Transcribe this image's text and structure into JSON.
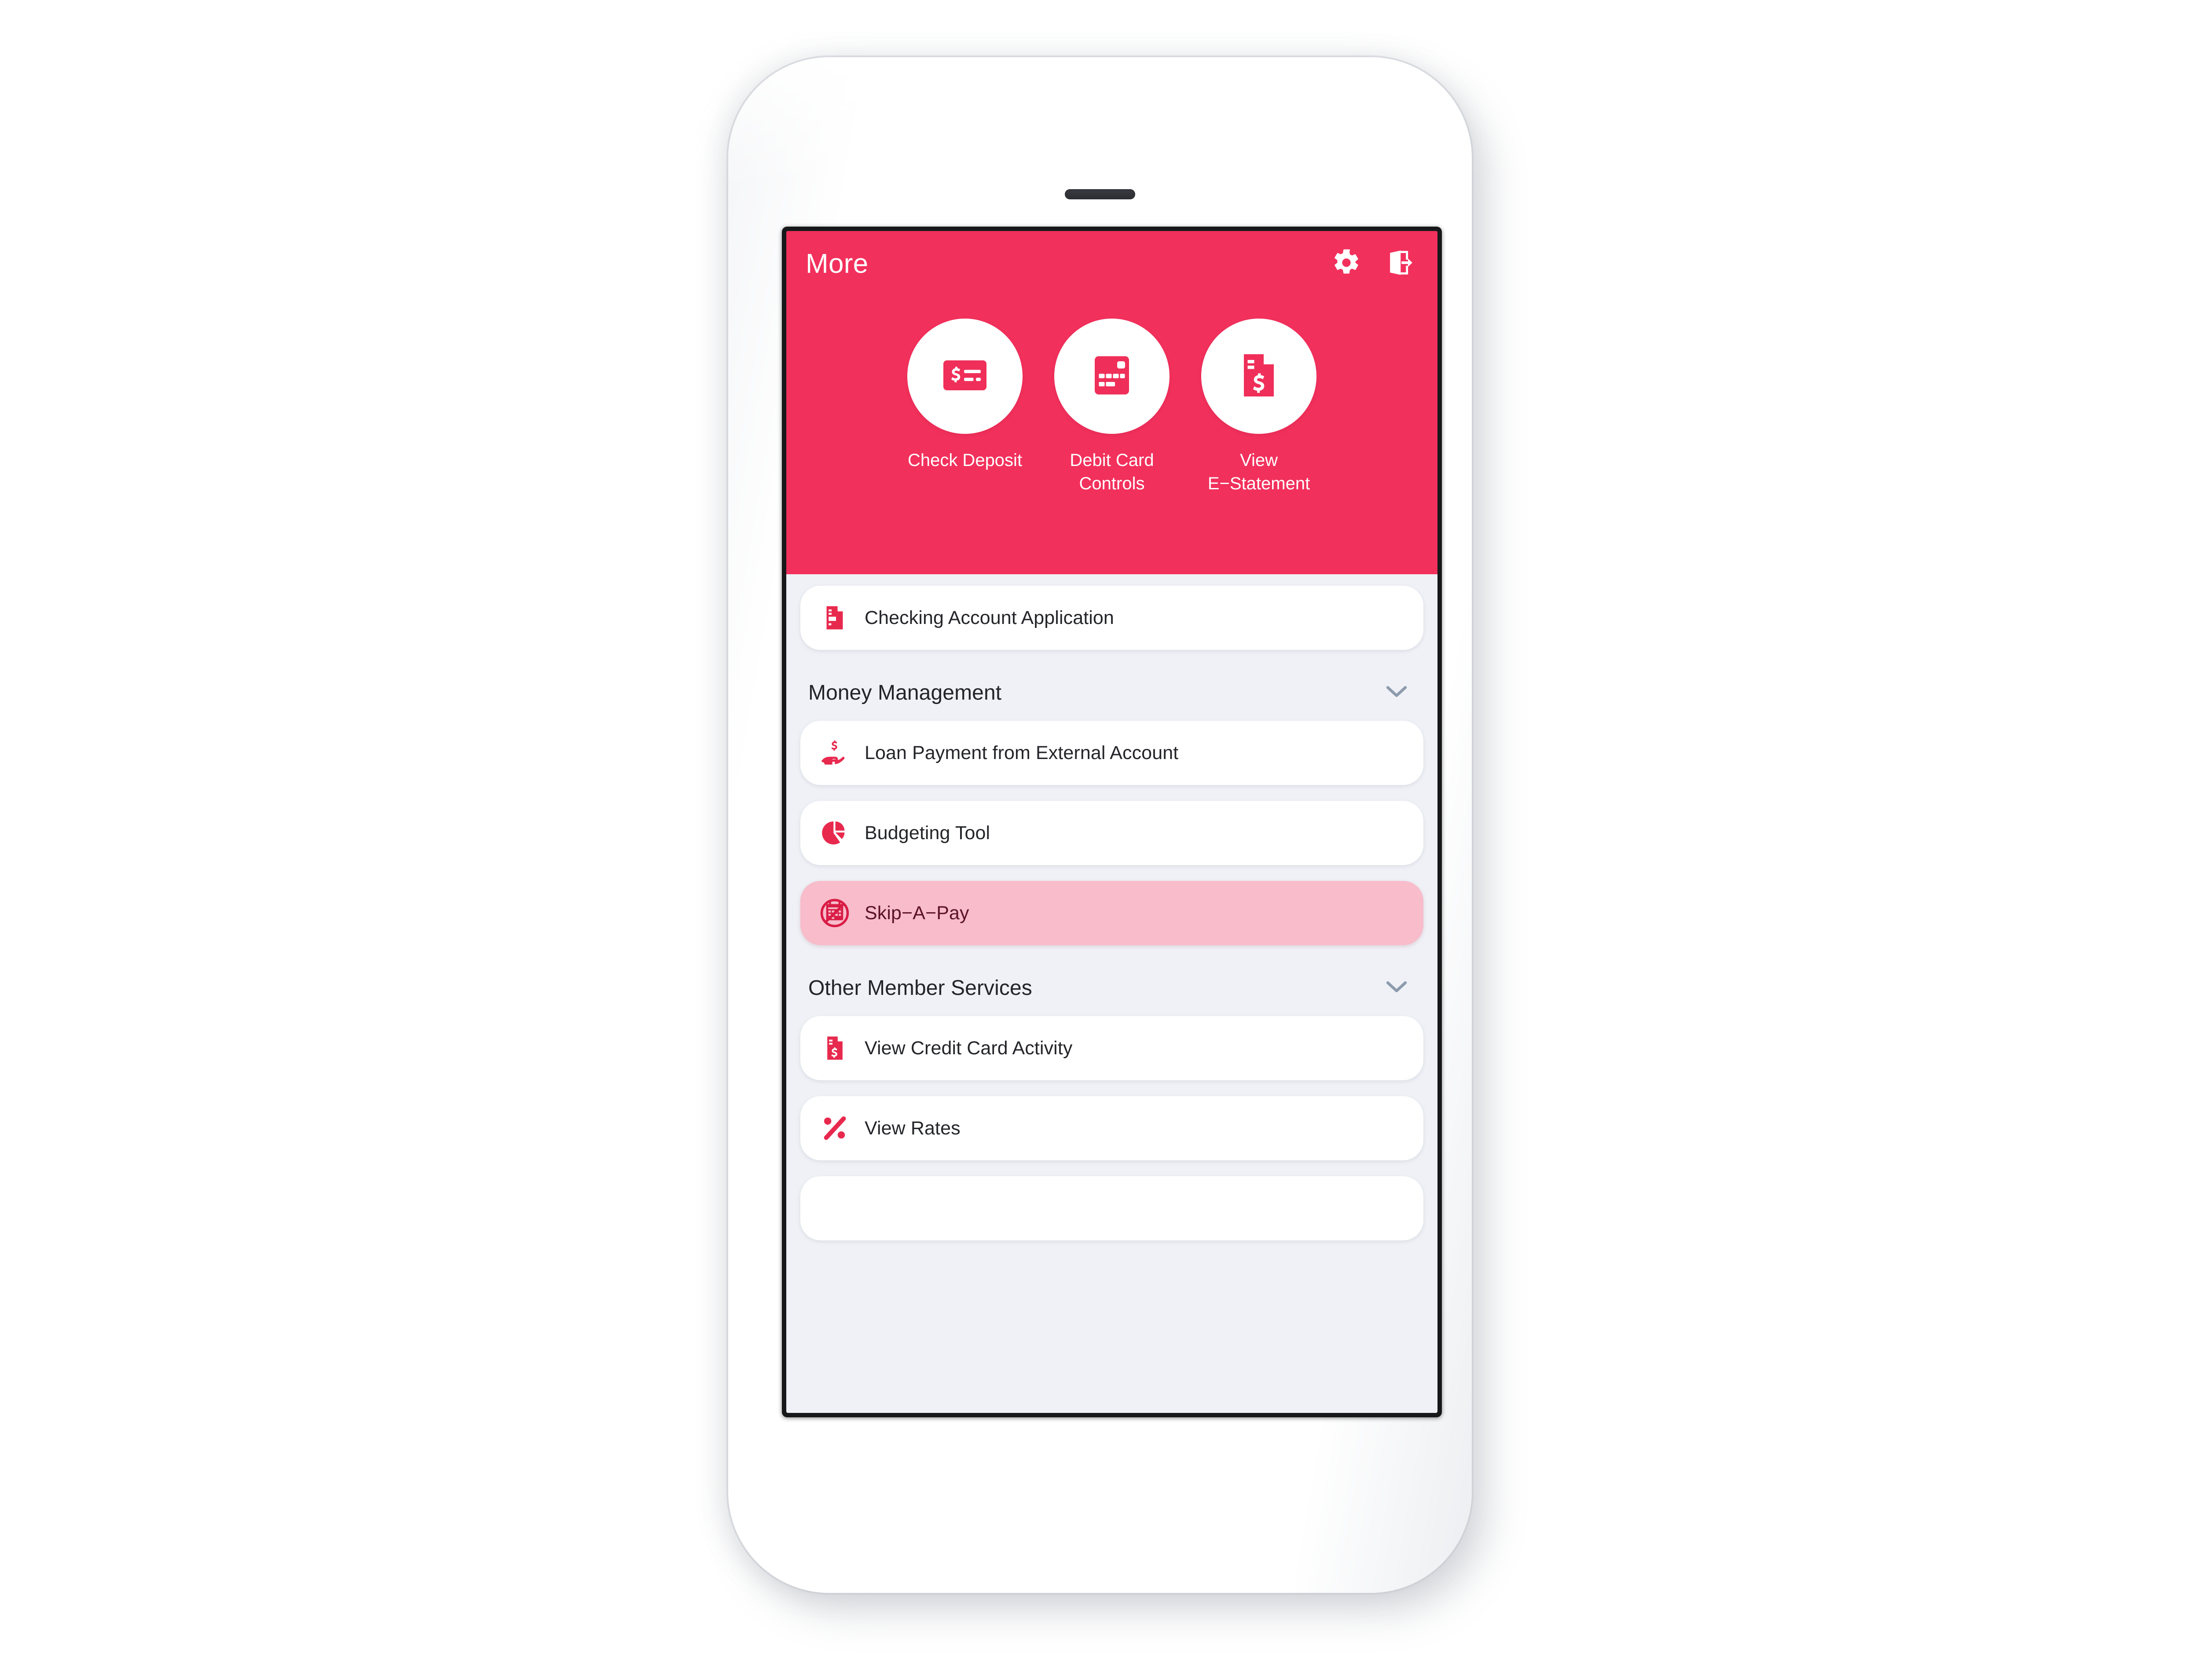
{
  "colors": {
    "brand_pink": "#F2305C",
    "icon_red": "#E8294E",
    "highlight_pink": "#F8BCCB",
    "list_background": "#EFF1F6",
    "card_white": "#FFFFFF",
    "text_dark": "#242529",
    "chevron_grey": "#8D9BAD"
  },
  "header": {
    "title": "More",
    "settings_icon": "gear-icon",
    "logout_icon": "logout-icon"
  },
  "quick_actions": [
    {
      "label": "Check Deposit",
      "icon": "check-deposit-icon"
    },
    {
      "label": "Debit Card Controls",
      "icon": "debit-card-icon"
    },
    {
      "label": "View E−Statement",
      "icon": "e-statement-icon"
    }
  ],
  "list": {
    "top_items": [
      {
        "label": "Checking Account Application",
        "icon": "document-list-icon",
        "highlighted": false
      }
    ],
    "sections": [
      {
        "title": "Money Management",
        "chevron": "chevron-down-icon",
        "items": [
          {
            "label": "Loan Payment from External Account",
            "icon": "hand-dollar-icon",
            "highlighted": false
          },
          {
            "label": "Budgeting Tool",
            "icon": "pie-chart-icon",
            "highlighted": false
          },
          {
            "label": "Skip−A−Pay",
            "icon": "no-calendar-icon",
            "highlighted": true
          }
        ]
      },
      {
        "title": "Other Member Services",
        "chevron": "chevron-down-icon",
        "items": [
          {
            "label": "View Credit Card Activity",
            "icon": "statement-dollar-icon",
            "highlighted": false
          },
          {
            "label": "View Rates",
            "icon": "percent-icon",
            "highlighted": false
          }
        ]
      }
    ]
  }
}
